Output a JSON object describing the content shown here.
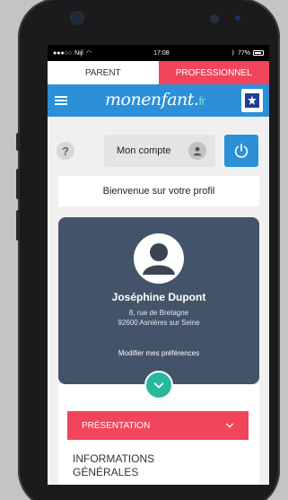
{
  "statusbar": {
    "carrier": "Nijl",
    "time": "17:08",
    "battery": "77%"
  },
  "switch": {
    "parent_label": "PARENT",
    "pro_label": "PROFESSIONNEL"
  },
  "appbar": {
    "logo_main": "monenfant",
    "logo_dot": ".",
    "logo_tld": "fr"
  },
  "toolbar": {
    "help_label": "?",
    "account_label": "Mon compte"
  },
  "welcome": {
    "text": "Bienvenue sur votre profil"
  },
  "profile": {
    "name": "Joséphine Dupont",
    "address_line1": "8, rue de Bretagne",
    "address_line2": "92600 Asnières sur Seine",
    "preferences_link": "Modifier mes préférences"
  },
  "section": {
    "header_label": "PRÉSENTATION",
    "title": "INFORMATIONS GÉNÉRALES"
  },
  "colors": {
    "accent_red": "#f2455b",
    "brand_blue": "#2b90d8",
    "card_slate": "#43536a",
    "teal": "#27b89e"
  },
  "icons": [
    "menu-icon",
    "caf-logo-icon",
    "question-icon",
    "user-icon",
    "power-icon",
    "chevron-down-icon"
  ]
}
